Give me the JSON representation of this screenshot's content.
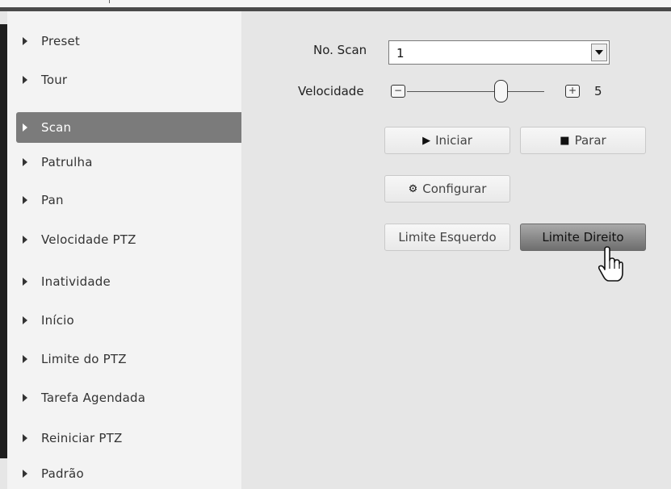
{
  "sidebar": {
    "items": [
      {
        "label": "Preset"
      },
      {
        "label": "Tour"
      },
      {
        "label": "Scan"
      },
      {
        "label": "Patrulha"
      },
      {
        "label": "Pan"
      },
      {
        "label": "Velocidade PTZ"
      },
      {
        "label": "Inatividade"
      },
      {
        "label": "Início"
      },
      {
        "label": "Limite do PTZ"
      },
      {
        "label": "Tarefa Agendada"
      },
      {
        "label": "Reiniciar PTZ"
      },
      {
        "label": "Padrão"
      }
    ],
    "active_index": 2
  },
  "scan": {
    "number_label": "No. Scan",
    "number_value": "1",
    "speed_label": "Velocidade",
    "speed_minus": "−",
    "speed_plus": "+",
    "speed_value": "5"
  },
  "buttons": {
    "start": "Iniciar",
    "stop": "Parar",
    "configure": "Configurar",
    "left_limit": "Limite Esquerdo",
    "right_limit": "Limite Direito"
  },
  "icons": {
    "start": "play-icon",
    "stop": "stop-icon",
    "configure": "gear-icon"
  },
  "colors": {
    "active_item": "#7b7b7b",
    "sidebar_bg": "#f3f3f3",
    "content_bg": "#e6e6e6"
  }
}
